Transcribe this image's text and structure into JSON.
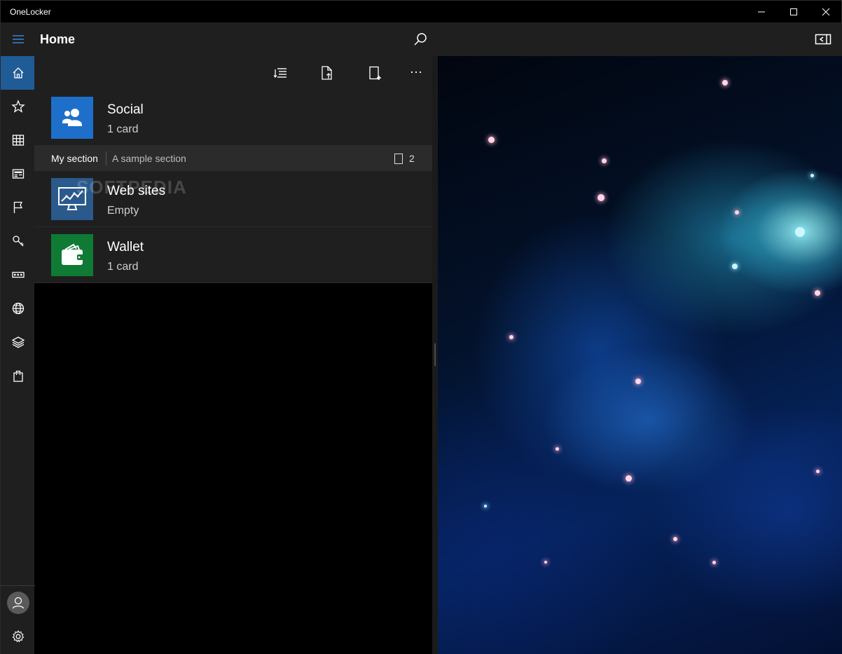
{
  "window": {
    "title": "OneLocker"
  },
  "header": {
    "title": "Home"
  },
  "nav": {
    "items": [
      "home-icon",
      "star-icon",
      "grid-icon",
      "card-icon",
      "flag-icon",
      "key-icon",
      "id-card-icon",
      "globe-icon",
      "layers-icon",
      "bag-icon"
    ],
    "active": "home-icon",
    "bottom": [
      "avatar-icon",
      "gear-icon"
    ]
  },
  "list": {
    "items": [
      {
        "title": "Social",
        "subtitle": "1 card",
        "icon": "people-icon",
        "color": "#1e6fc9"
      },
      {
        "title": "Web sites",
        "subtitle": "Empty",
        "icon": "monitor-chart-icon",
        "color": "#2a5a8c"
      },
      {
        "title": "Wallet",
        "subtitle": "1 card",
        "icon": "wallet-icon",
        "color": "#0f7a34"
      }
    ],
    "section": {
      "name": "My section",
      "description": "A sample section",
      "count": "2"
    }
  },
  "watermark": "SOFTPEDIA",
  "colors": {
    "accent": "#1f5c96",
    "surface": "#1f1f1f",
    "section": "#2b2b2b"
  }
}
